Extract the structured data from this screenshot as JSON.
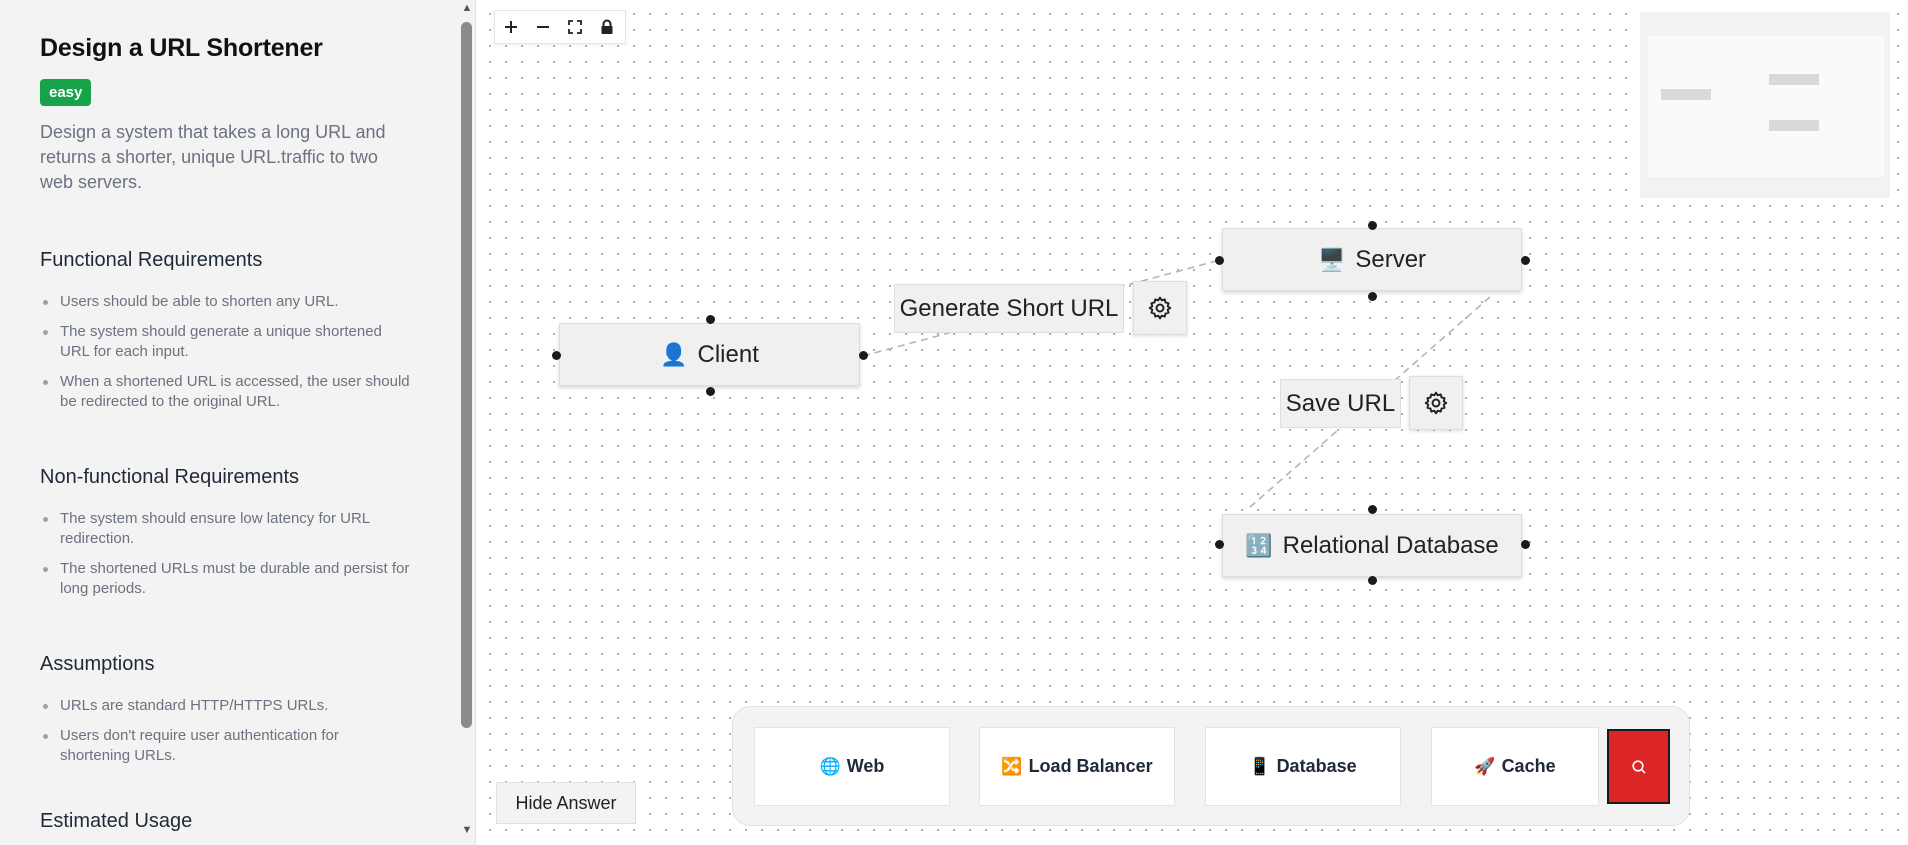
{
  "problem": {
    "title": "Design a URL Shortener",
    "difficulty": "easy",
    "description": "Design a system that takes a long URL and returns a shorter, unique URL.traffic to two web servers.",
    "sections": [
      {
        "title": "Functional Requirements",
        "items": [
          "Users should be able to shorten any URL.",
          "The system should generate a unique shortened URL for each input.",
          "When a shortened URL is accessed, the user should be redirected to the original URL."
        ]
      },
      {
        "title": "Non-functional Requirements",
        "items": [
          "The system should ensure low latency for URL redirection.",
          "The shortened URLs must be durable and persist for long periods."
        ]
      },
      {
        "title": "Assumptions",
        "items": [
          "URLs are standard HTTP/HTTPS URLs.",
          "Users don't require user authentication for shortening URLs."
        ]
      },
      {
        "title": "Estimated Usage",
        "items": []
      }
    ]
  },
  "canvas": {
    "controls": [
      "zoom-in",
      "zoom-out",
      "fit-view",
      "lock"
    ],
    "nodes": {
      "client": {
        "label": "Client",
        "icon": "👤"
      },
      "server": {
        "label": "Server",
        "icon": "🖥️"
      },
      "database": {
        "label": "Relational Database",
        "icon": "🔢"
      }
    },
    "edges": {
      "generate": {
        "label": "Generate Short URL"
      },
      "save": {
        "label": "Save URL"
      }
    },
    "hide_answer_label": "Hide Answer"
  },
  "palette": {
    "items": [
      {
        "label": "Web",
        "icon": "🌐"
      },
      {
        "label": "Load Balancer",
        "icon": "🔀"
      },
      {
        "label": "Database",
        "icon": "📱"
      },
      {
        "label": "Cache",
        "icon": "🚀"
      }
    ]
  },
  "colors": {
    "badge": "#16a34a",
    "search_button": "#dc2626"
  }
}
